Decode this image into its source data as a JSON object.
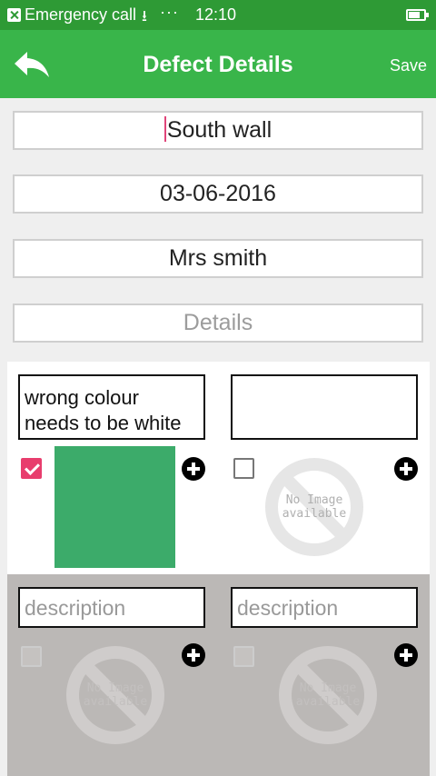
{
  "status_bar": {
    "notification_text": "Emergency call",
    "time": "12:10",
    "icons": [
      "close-box-icon",
      "download-icon",
      "more-dots-icon",
      "battery-icon"
    ]
  },
  "app_bar": {
    "title": "Defect Details",
    "save_label": "Save",
    "back_icon": "back-arrow-icon",
    "color": "#39b54a"
  },
  "form": {
    "location": "South wall",
    "date": "03-06-2016",
    "name": "Mrs smith",
    "details_placeholder": "Details"
  },
  "photo_cards": [
    {
      "description": "wrong colour\nneeds to be white",
      "checked": true,
      "has_image": true
    },
    {
      "description": "",
      "checked": false,
      "has_image": false,
      "no_image_text": "No Image available"
    },
    {
      "description_placeholder": "description",
      "checked": false,
      "has_image": false,
      "no_image_text": "No Image available"
    },
    {
      "description_placeholder": "description",
      "checked": false,
      "has_image": false,
      "no_image_text": "No Image available"
    }
  ],
  "colors": {
    "accent_pink": "#e83d6d",
    "status_bar": "#2e9a35"
  }
}
